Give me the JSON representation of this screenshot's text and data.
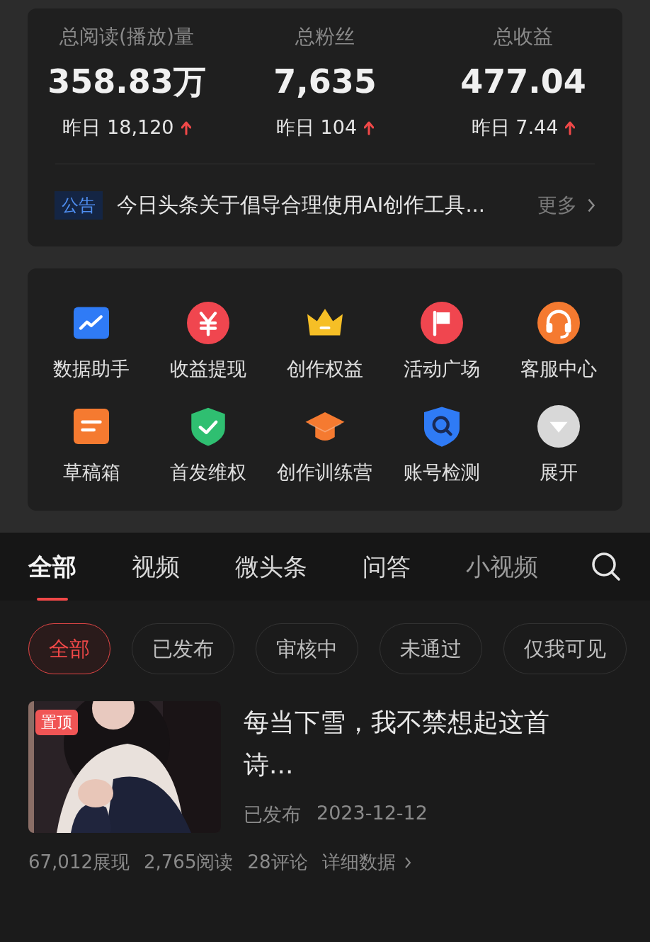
{
  "stats": [
    {
      "label": "总阅读(播放)量",
      "value": "358.83万",
      "yesterday": "昨日 18,120",
      "up": true
    },
    {
      "label": "总粉丝",
      "value": "7,635",
      "yesterday": "昨日 104",
      "up": true
    },
    {
      "label": "总收益",
      "value": "477.04",
      "yesterday": "昨日 7.44",
      "up": true
    }
  ],
  "notice": {
    "tag": "公告",
    "text": "今日头条关于倡导合理使用AI创作工具...",
    "more": "更多"
  },
  "tools": [
    {
      "kind": "chart",
      "label": "数据助手"
    },
    {
      "kind": "yen",
      "label": "收益提现"
    },
    {
      "kind": "crown",
      "label": "创作权益"
    },
    {
      "kind": "flag",
      "label": "活动广场"
    },
    {
      "kind": "headset",
      "label": "客服中心"
    },
    {
      "kind": "draft",
      "label": "草稿箱"
    },
    {
      "kind": "shield",
      "label": "首发维权"
    },
    {
      "kind": "cap",
      "label": "创作训练营"
    },
    {
      "kind": "check",
      "label": "账号检测"
    },
    {
      "kind": "expand",
      "label": "展开"
    }
  ],
  "tabs": [
    {
      "label": "全部",
      "selected": true
    },
    {
      "label": "视频",
      "selected": false
    },
    {
      "label": "微头条",
      "selected": false
    },
    {
      "label": "问答",
      "selected": false
    },
    {
      "label": "小视频",
      "selected": false
    }
  ],
  "filters": [
    {
      "label": "全部",
      "selected": true
    },
    {
      "label": "已发布",
      "selected": false
    },
    {
      "label": "审核中",
      "selected": false
    },
    {
      "label": "未通过",
      "selected": false
    },
    {
      "label": "仅我可见",
      "selected": false
    }
  ],
  "article": {
    "badge": "置顶",
    "title": "每当下雪，我不禁想起这首诗...",
    "status": "已发布",
    "date": "2023-12-12",
    "metrics": [
      "67,012展现",
      "2,765阅读",
      "28评论"
    ],
    "details": "详细数据"
  }
}
